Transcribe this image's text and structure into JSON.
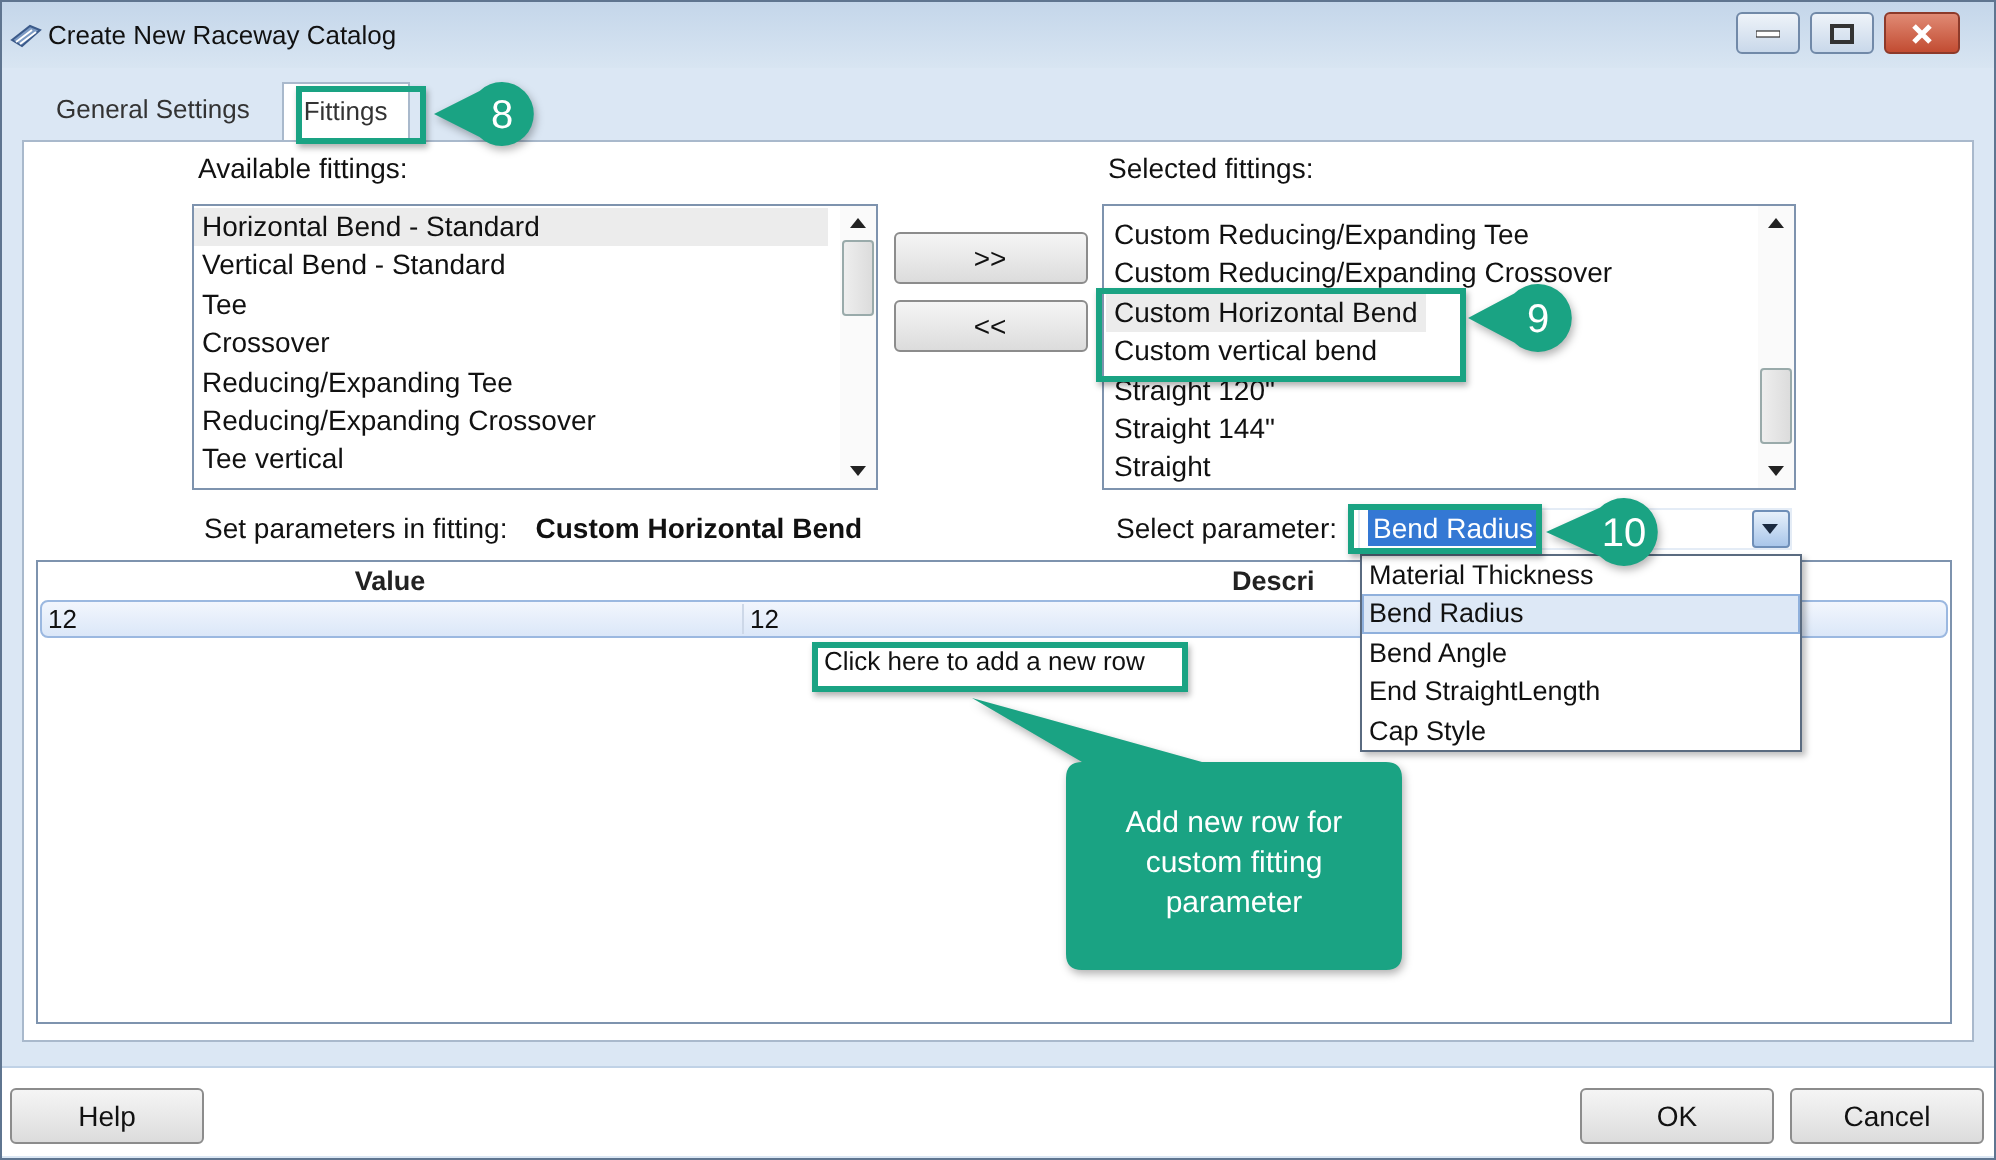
{
  "window": {
    "title": "Create New Raceway Catalog"
  },
  "tabs": [
    {
      "label": "General Settings",
      "selected": false
    },
    {
      "label": "Fittings",
      "selected": true
    }
  ],
  "available": {
    "label": "Available fittings:",
    "items": [
      {
        "label": "Horizontal Bend - Standard",
        "selected": true
      },
      {
        "label": "Vertical Bend - Standard",
        "selected": false
      },
      {
        "label": "Tee",
        "selected": false
      },
      {
        "label": "Crossover",
        "selected": false
      },
      {
        "label": "Reducing/Expanding Tee",
        "selected": false
      },
      {
        "label": "Reducing/Expanding Crossover",
        "selected": false
      },
      {
        "label": "Tee vertical",
        "selected": false
      }
    ]
  },
  "transfer_buttons": [
    ">>",
    "<<"
  ],
  "selected_fittings": {
    "label": "Selected fittings:",
    "items": [
      {
        "label": "Custom Reducing/Expanding Tee",
        "selected": false
      },
      {
        "label": "Custom Reducing/Expanding Crossover",
        "selected": false
      },
      {
        "label": "Custom Horizontal Bend",
        "selected": true
      },
      {
        "label": "Custom vertical bend",
        "selected": false
      },
      {
        "label": "Straight 120\"",
        "selected": false
      },
      {
        "label": "Straight 144\"",
        "selected": false
      },
      {
        "label": "Straight",
        "selected": false
      }
    ]
  },
  "fitting_parameters": {
    "label": "Set parameters in fitting:",
    "fitting": "Custom Horizontal Bend"
  },
  "parameter_select": {
    "label": "Select parameter:",
    "value": "Bend Radius",
    "expanded": true,
    "options": [
      {
        "label": "Material Thickness",
        "selected": false
      },
      {
        "label": "Bend Radius",
        "selected": true
      },
      {
        "label": "Bend Angle",
        "selected": false
      },
      {
        "label": "End StraightLength",
        "selected": false
      },
      {
        "label": "Cap Style",
        "selected": false
      }
    ]
  },
  "table": {
    "columns": [
      "Value",
      "Descri"
    ],
    "rows": [
      {
        "cells": [
          "12",
          "12"
        ],
        "selected": true
      }
    ],
    "add_row": "Click here to add a new row"
  },
  "annotations": [
    {
      "kind": "badge",
      "text": "8"
    },
    {
      "kind": "badge",
      "text": "9"
    },
    {
      "kind": "badge",
      "text": "10"
    },
    {
      "kind": "callout",
      "text": "Add new row for custom fitting parameter"
    }
  ],
  "footer_buttons": {
    "left": [
      "Help"
    ],
    "right": [
      "OK",
      "Cancel"
    ]
  }
}
